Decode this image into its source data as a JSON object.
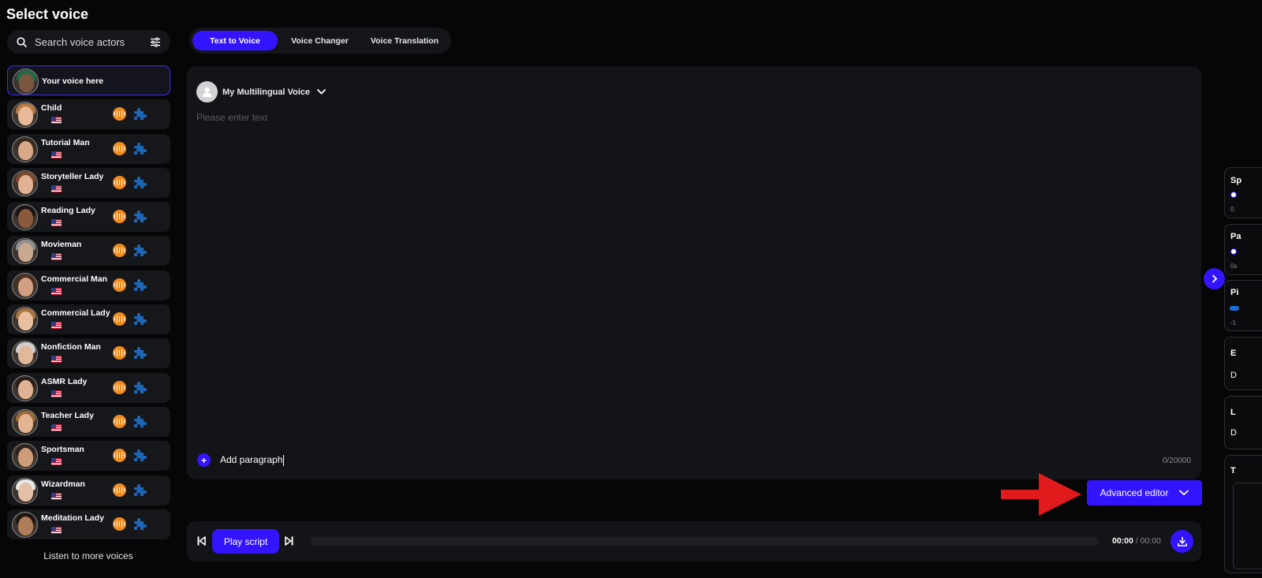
{
  "sidebar": {
    "title": "Select voice",
    "search_placeholder": "Search voice actors",
    "voices": [
      {
        "name": "Your voice here",
        "selected": true,
        "skin": "#7a5540",
        "hair": "#1f6b46"
      },
      {
        "name": "Child",
        "skin": "#e7b998",
        "hair": "#b57a45"
      },
      {
        "name": "Tutorial Man",
        "skin": "#d9a887",
        "hair": "#3a2b22"
      },
      {
        "name": "Storyteller Lady",
        "skin": "#e2b191",
        "hair": "#7b4a2c"
      },
      {
        "name": "Reading Lady",
        "skin": "#8a5a3c",
        "hair": "#1b1411"
      },
      {
        "name": "Movieman",
        "skin": "#c9a890",
        "hair": "#8f8f8f"
      },
      {
        "name": "Commercial Man",
        "skin": "#d2a081",
        "hair": "#4b3022"
      },
      {
        "name": "Commercial Lady",
        "skin": "#e8bf9f",
        "hair": "#a8743f"
      },
      {
        "name": "Nonfiction Man",
        "skin": "#e2b89b",
        "hair": "#cfcfcf"
      },
      {
        "name": "ASMR Lady",
        "skin": "#e0b394",
        "hair": "#2a1c16"
      },
      {
        "name": "Teacher Lady",
        "skin": "#e3b491",
        "hair": "#9a6a3c"
      },
      {
        "name": "Sportsman",
        "skin": "#cf9c7a",
        "hair": "#2d2119"
      },
      {
        "name": "Wizardman",
        "skin": "#e4c0a8",
        "hair": "#e8e8e8"
      },
      {
        "name": "Meditation Lady",
        "skin": "#b07d5a",
        "hair": "#1e1410"
      }
    ],
    "listen_more": "Listen to more voices"
  },
  "tabs": [
    {
      "label": "Text to Voice",
      "active": true
    },
    {
      "label": "Voice Changer",
      "active": false
    },
    {
      "label": "Voice Translation",
      "active": false
    }
  ],
  "editor": {
    "voice_label": "My Multilingual Voice",
    "placeholder": "Please enter text",
    "add_paragraph": "Add paragraph",
    "char_count": "0/20000"
  },
  "advanced_editor": {
    "label": "Advanced editor"
  },
  "player": {
    "play_label": "Play script",
    "current_time": "00:00",
    "total_time": "/ 00:00",
    "progress": 0
  },
  "right_panel": {
    "cards": [
      {
        "title": "Sp",
        "sub": "0.",
        "type": "slider"
      },
      {
        "title": "Pa",
        "sub": "0s",
        "type": "slider"
      },
      {
        "title": "Pi",
        "sub": "-1",
        "type": "slider-blue"
      },
      {
        "title": "E",
        "sub": "D",
        "type": "select"
      },
      {
        "title": "L",
        "sub": "D",
        "type": "select"
      },
      {
        "title": "T",
        "sub": "",
        "type": "box"
      }
    ]
  },
  "colors": {
    "accent": "#3314ff",
    "orange": "#f08a1d",
    "panel": "#131417",
    "arrow": "#e11b1b"
  }
}
